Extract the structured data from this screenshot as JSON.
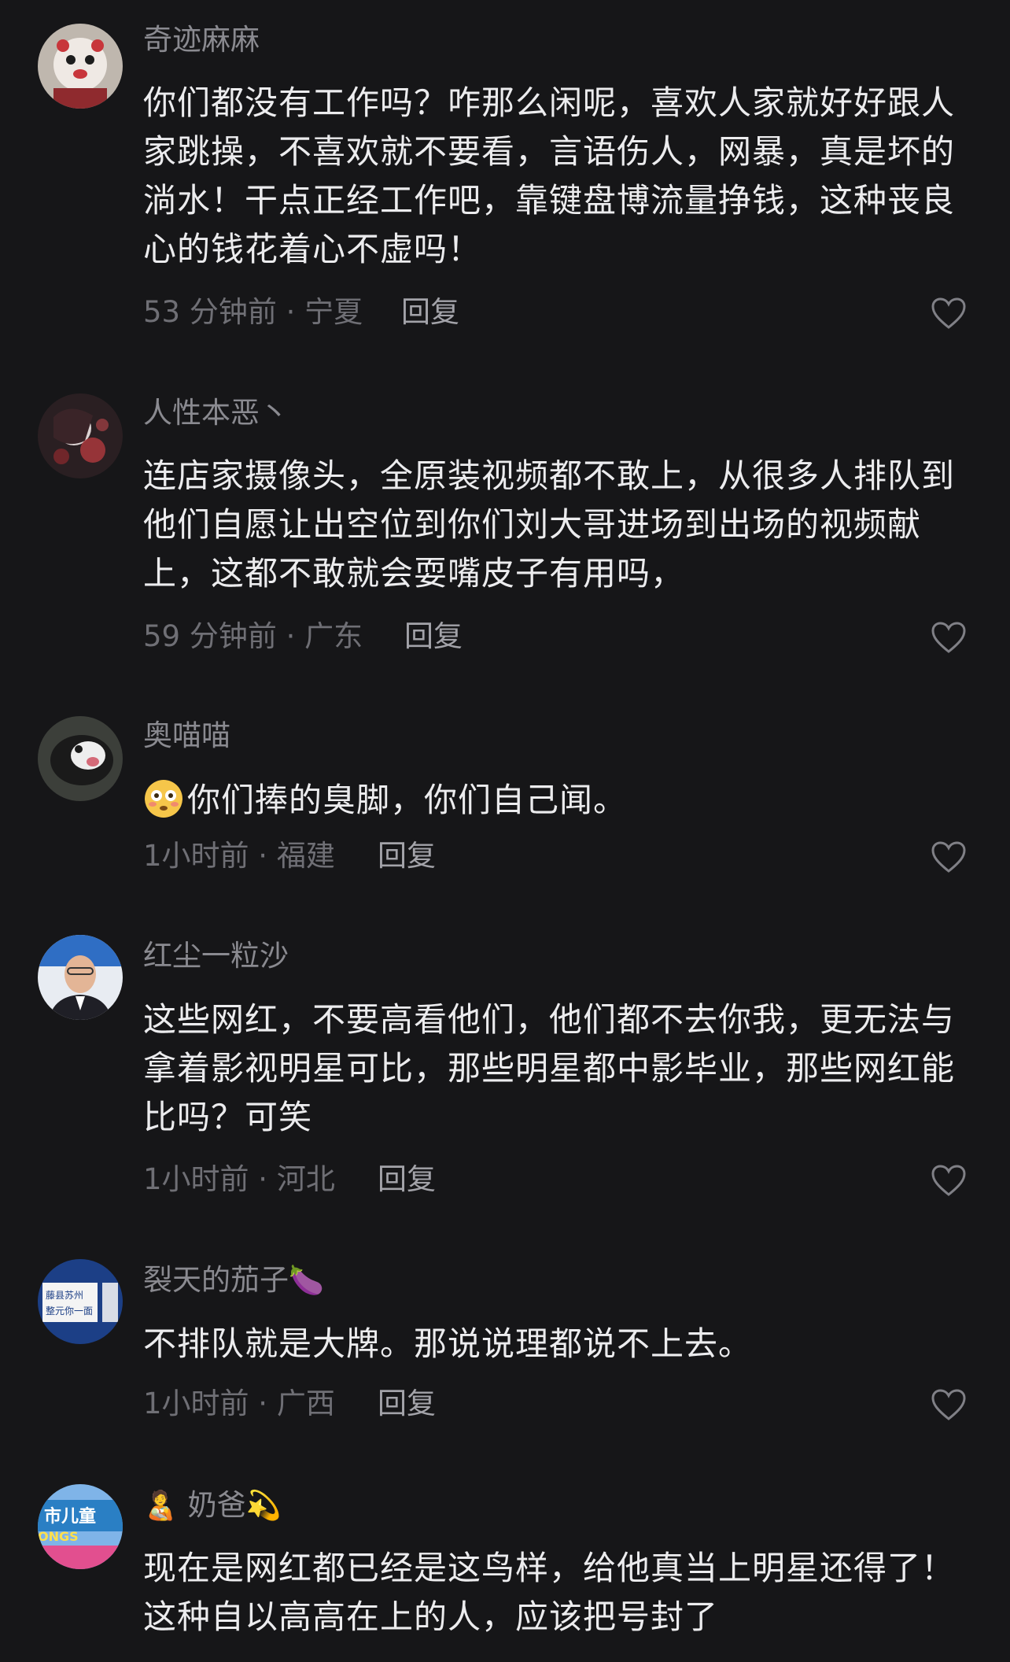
{
  "comments": [
    {
      "username": "奇迹麻麻",
      "text": "你们都没有工作吗？咋那么闲呢，喜欢人家就好好跟人家跳操，不喜欢就不要看，言语伤人，网暴，真是坏的淌水！干点正经工作吧，靠键盘博流量挣钱，这种丧良心的钱花着心不虚吗！",
      "meta": "53 分钟前 · 宁夏",
      "reply": "回复"
    },
    {
      "username": "人性本恶丶",
      "text": "连店家摄像头，全原装视频都不敢上，从很多人排队到他们自愿让出空位到你们刘大哥进场到出场的视频献上，这都不敢就会耍嘴皮子有用吗，",
      "meta": "59 分钟前 · 广东",
      "reply": "回复"
    },
    {
      "username": "奥喵喵",
      "text": "你们捧的臭脚，你们自己闻。",
      "meta": "1小时前 · 福建",
      "reply": "回复"
    },
    {
      "username": "红尘一粒沙",
      "text": "这些网红，不要高看他们，他们都不去你我，更无法与拿着影视明星可比，那些明星都中影毕业，那些网红能比吗？可笑",
      "meta": "1小时前 · 河北",
      "reply": "回复"
    },
    {
      "username": "裂天的茄子",
      "username_emoji": "🍆",
      "text": "不排队就是大牌。那说说理都说不上去。",
      "meta": "1小时前 · 广西",
      "reply": "回复"
    },
    {
      "username": "奶爸",
      "username_emoji_before": "🧑‍🍼",
      "username_emoji_after": "💫",
      "text": "现在是网红都已经是这鸟样，给他真当上明星还得了！这种自以高高在上的人，应该把号封了"
    }
  ],
  "avatar_texts": {
    "c5_line1": "藤县苏州",
    "c5_line2": "整元你一面",
    "c6_line1": "市儿童",
    "c6_line2": "ONGS"
  },
  "colors": {
    "background": "#161618",
    "text": "#ececee",
    "muted": "#6f6f75",
    "username": "#8a8a90"
  }
}
